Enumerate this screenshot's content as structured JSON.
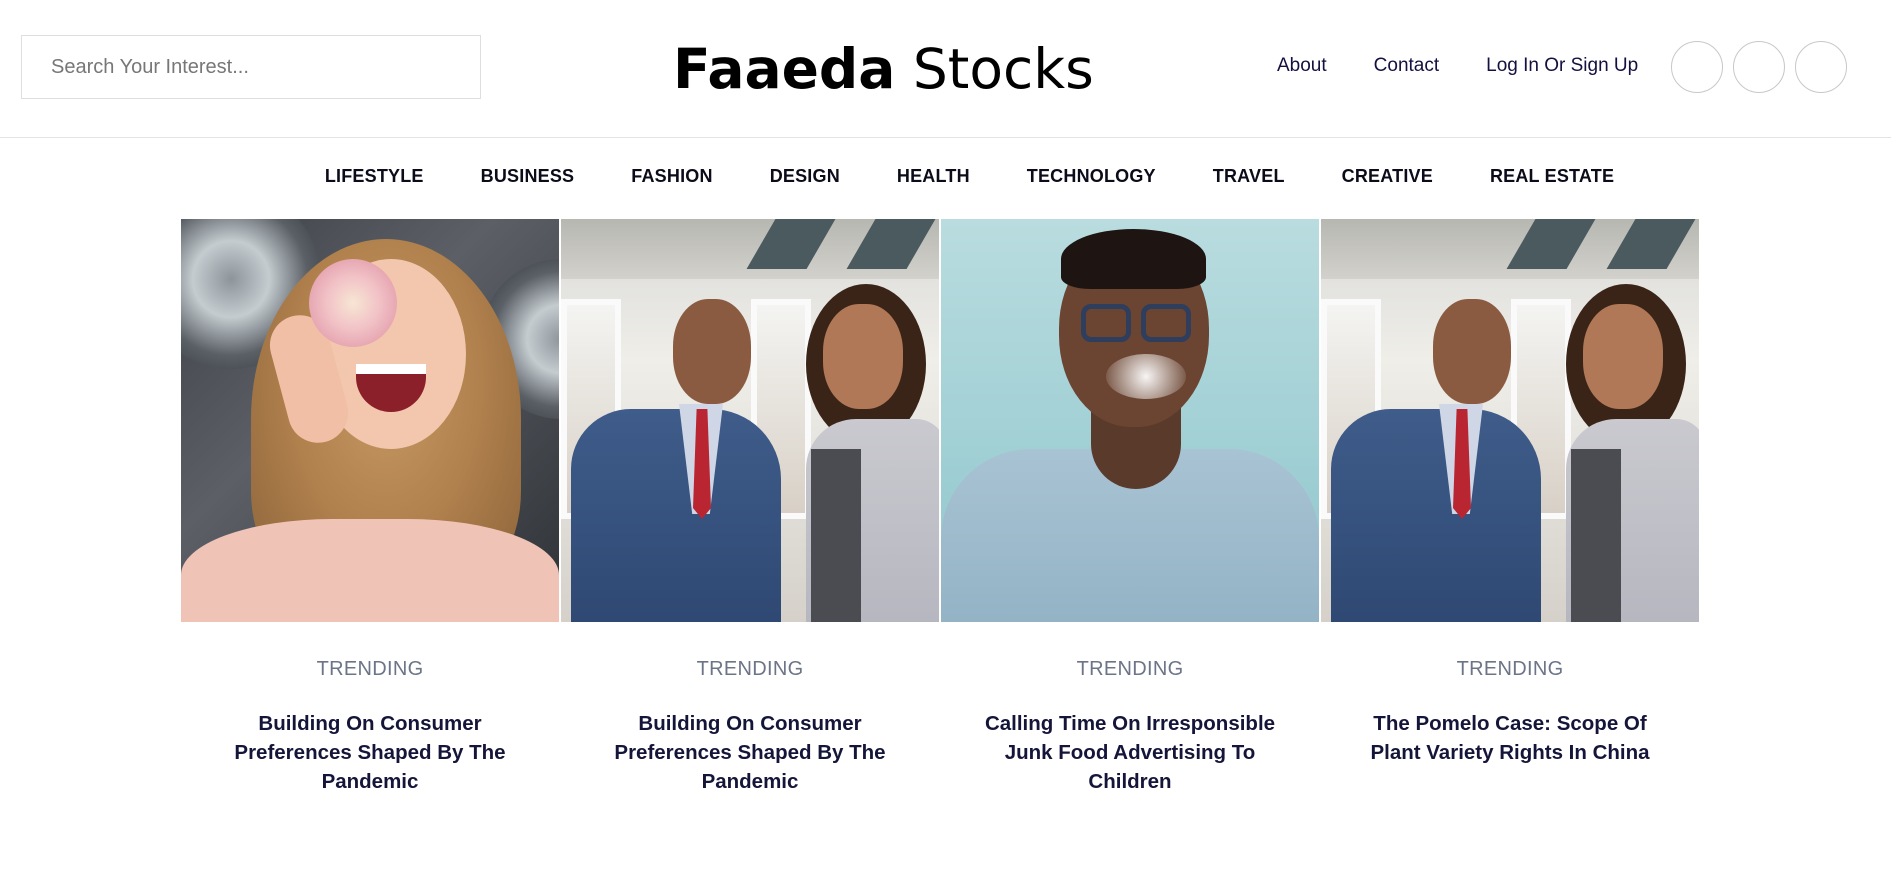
{
  "header": {
    "search_placeholder": "Search Your Interest...",
    "logo_bold": "Faaeda",
    "logo_light": "Stocks",
    "links": [
      "About",
      "Contact",
      "Log In Or Sign Up"
    ]
  },
  "categories": [
    "LIFESTYLE",
    "BUSINESS",
    "FASHION",
    "DESIGN",
    "HEALTH",
    "TECHNOLOGY",
    "TRAVEL",
    "CREATIVE",
    "REAL ESTATE"
  ],
  "cards": [
    {
      "tag": "TRENDING",
      "title": "Building On Consumer Preferences Shaped By The Pandemic",
      "image": "woman-with-donut-photo"
    },
    {
      "tag": "TRENDING",
      "title": "Building On Consumer Preferences Shaped By The Pandemic",
      "image": "business-couple-photo"
    },
    {
      "tag": "TRENDING",
      "title": "Calling Time On Irresponsible Junk Food Advertising To Children",
      "image": "man-with-glasses-smoke-photo"
    },
    {
      "tag": "TRENDING",
      "title": "The Pomelo Case: Scope Of Plant Variety Rights In China",
      "image": "business-couple-photo"
    }
  ]
}
